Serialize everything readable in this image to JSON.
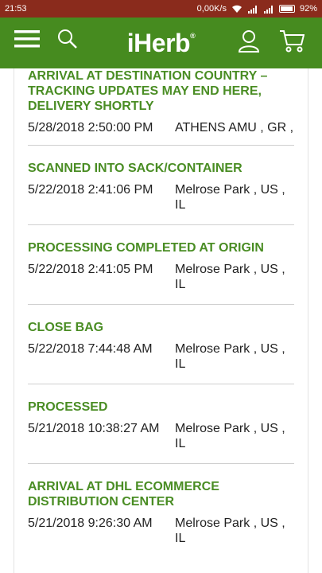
{
  "status_bar": {
    "time": "21:53",
    "network_speed": "0,00K/s",
    "battery_level": "92%",
    "battery_fraction": 0.92
  },
  "header": {
    "logo_text": "iHerb",
    "logo_mark": "®",
    "brand_color": "#468b1f"
  },
  "tracking_events": [
    {
      "title": "ARRIVAL AT DESTINATION COUNTRY – TRACKING UPDATES MAY END HERE, DELIVERY SHORTLY",
      "time": "5/28/2018 2:50:00 PM",
      "location": "ATHENS AMU , GR ,"
    },
    {
      "title": "SCANNED INTO SACK/CONTAINER",
      "time": "5/22/2018 2:41:06 PM",
      "location": "Melrose Park , US , IL"
    },
    {
      "title": "PROCESSING COMPLETED AT ORIGIN",
      "time": "5/22/2018 2:41:05 PM",
      "location": "Melrose Park , US , IL"
    },
    {
      "title": "CLOSE BAG",
      "time": "5/22/2018 7:44:48 AM",
      "location": "Melrose Park , US , IL"
    },
    {
      "title": "PROCESSED",
      "time": "5/21/2018 10:38:27 AM",
      "location": "Melrose Park , US , IL"
    },
    {
      "title": "ARRIVAL AT DHL ECOMMERCE DISTRIBUTION CENTER",
      "time": "5/21/2018 9:26:30 AM",
      "location": "Melrose Park , US , IL"
    }
  ]
}
